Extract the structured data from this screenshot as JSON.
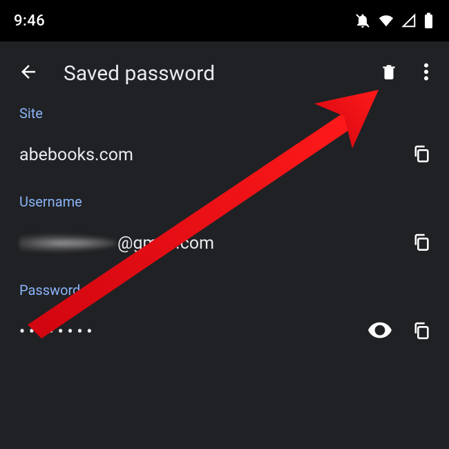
{
  "statusbar": {
    "time": "9:46"
  },
  "appbar": {
    "title": "Saved password"
  },
  "fields": {
    "site": {
      "label": "Site",
      "value": "abebooks.com"
    },
    "username": {
      "label": "Username",
      "value_suffix": "@gmail.com"
    },
    "password": {
      "label": "Password",
      "masked": "••••••••"
    }
  },
  "colors": {
    "accent": "#8ab4f8",
    "surface": "#202124",
    "annotation": "#e30613"
  }
}
